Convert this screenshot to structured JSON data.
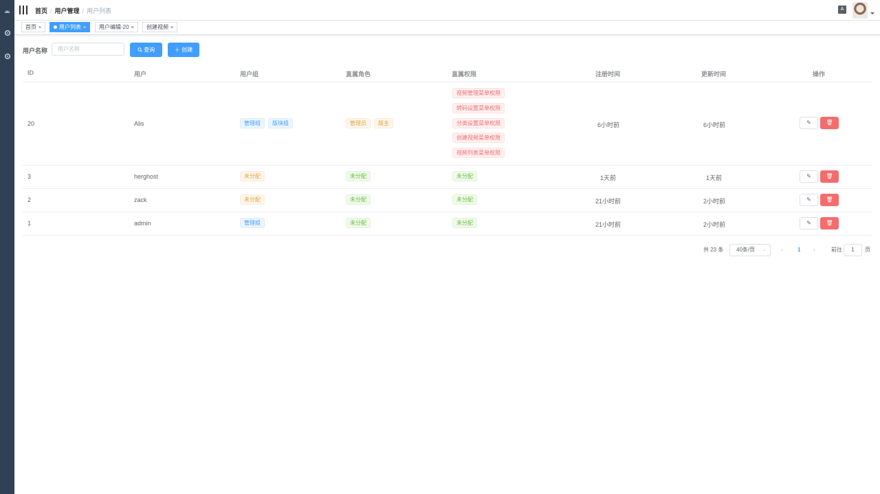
{
  "sidebar": {
    "icons": [
      "dashboard-icon",
      "settings-icon",
      "settings-icon-2"
    ]
  },
  "navbar": {
    "breadcrumb": [
      "首页",
      "用户管理",
      "用户列表"
    ],
    "lang_label": "A"
  },
  "tags": [
    {
      "label": "首页"
    },
    {
      "label": "用户列表",
      "active": true
    },
    {
      "label": "用户编辑-20"
    },
    {
      "label": "创建视频"
    }
  ],
  "filter": {
    "label": "用户名称",
    "placeholder": "用户名称",
    "query_button": "查询",
    "create_button": "创建"
  },
  "table": {
    "headers": [
      "ID",
      "用户",
      "用户组",
      "直属角色",
      "直属权限",
      "注册时间",
      "更新时间",
      "操作"
    ],
    "rows": [
      {
        "id": "20",
        "user": "Alis",
        "groups": [
          "管理组",
          "版块组"
        ],
        "roles": [
          "管理员",
          "版主"
        ],
        "permissions": [
          "视频管理菜单权限",
          "转码设置菜单权限",
          "分类设置菜单权限",
          "创建视频菜单权限",
          "视频列表菜单权限"
        ],
        "registered": "6小时前",
        "updated": "6小时前"
      },
      {
        "id": "3",
        "user": "herghost",
        "groups": [
          "未分配"
        ],
        "roles": [
          "未分配"
        ],
        "permissions": [
          "未分配"
        ],
        "registered": "1天前",
        "updated": "1天前"
      },
      {
        "id": "2",
        "user": "zack",
        "groups": [
          "未分配"
        ],
        "roles": [
          "未分配"
        ],
        "permissions": [
          "未分配"
        ],
        "registered": "21小时前",
        "updated": "2小时前"
      },
      {
        "id": "1",
        "user": "admin",
        "groups": [
          "管理组"
        ],
        "roles": [
          "未分配"
        ],
        "permissions": [
          "未分配"
        ],
        "registered": "21小时前",
        "updated": "2小时前"
      }
    ]
  },
  "pagination": {
    "total": "共 23 条",
    "page_size": "40条/页",
    "current_page": "1",
    "goto_label": "前往",
    "goto_value": "1",
    "page_suffix": "页"
  },
  "colors": {
    "primary": "#409eff",
    "danger": "#f56c6c",
    "sidebar": "#304156"
  }
}
